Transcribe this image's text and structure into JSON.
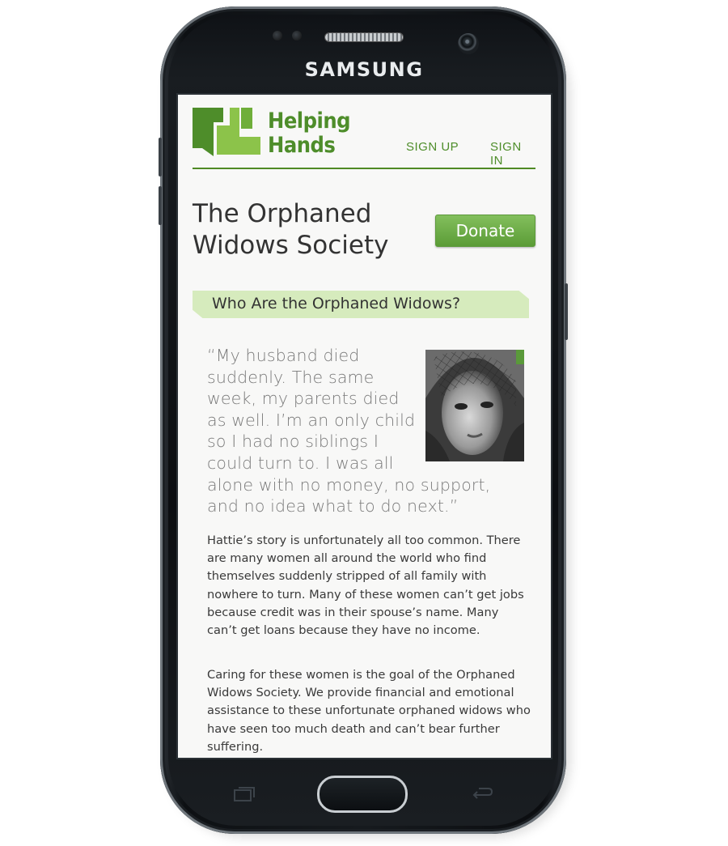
{
  "device": {
    "brand": "SAMSUNG"
  },
  "header": {
    "logo_line1": "Helping",
    "logo_line2": "Hands",
    "nav": [
      {
        "label": "SIGN UP"
      },
      {
        "label": "SIGN IN"
      }
    ]
  },
  "page": {
    "title": "The Orphaned Widows Society",
    "donate_label": "Donate",
    "section_heading": "Who Are the Orphaned Widows?",
    "quote": "“My husband died suddenly. The same week, my parents died as well. I’m an only child so I had no siblings I could turn to. I was all alone with no money, no support, and no idea what to do next.”",
    "paragraphs": [
      "Hattie’s story is unfortunately all too common. There are many women all around the world who find themselves suddenly stripped of all family with nowhere to turn. Many of these women can’t get jobs because credit was in their spouse’s name. Many can’t get loans because they have no income.",
      "Caring for these women is the goal of the Orphaned Widows Society. We provide financial and emotional assistance to these unfortunate orphaned widows who have seen too much death and can’t bear further suffering."
    ]
  },
  "colors": {
    "brand_green": "#4e8d2a",
    "banner_green": "#d6ebbd",
    "button_green": "#6aaa44"
  },
  "icons": {
    "logo": "helping-hands-logo-icon",
    "home": "home-button",
    "recent": "recent-apps-icon",
    "back": "back-icon"
  }
}
